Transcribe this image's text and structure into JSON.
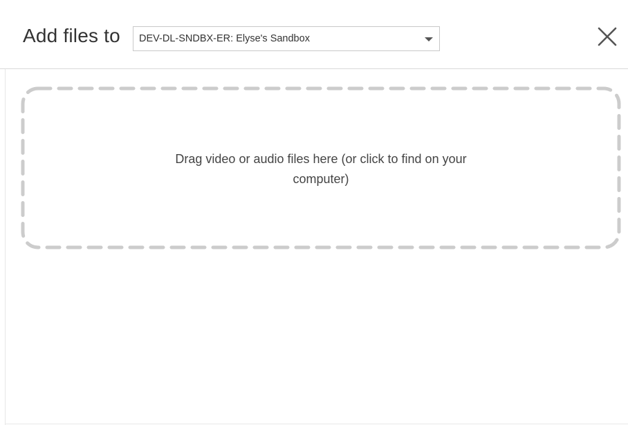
{
  "dialog": {
    "title": "Add files to",
    "project_select": {
      "selected_value": "DEV-DL-SNDBX-ER: Elyse's Sandbox",
      "icon": "caret-down-icon"
    },
    "close": {
      "icon": "close-icon"
    },
    "dropzone": {
      "text": "Drag video or audio files here (or click to find on your computer)",
      "border_style": "dashed"
    }
  },
  "colors": {
    "text": "#333333",
    "border_dashed": "#cccccc",
    "divider": "#d9d9d9",
    "icon": "#555555"
  }
}
